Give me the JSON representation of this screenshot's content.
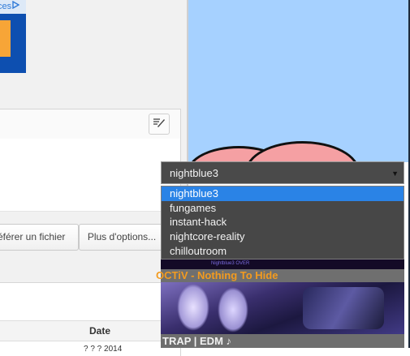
{
  "ad": {
    "label": "ces",
    "icon": "adchoices-icon"
  },
  "toolbar": {
    "edit_icon": "edit-icon"
  },
  "buttons": {
    "transfer_label": "éférer un fichier",
    "more_label": "Plus d'options..."
  },
  "table": {
    "header_date": "Date",
    "row_date": "? ? ? 2014"
  },
  "player": {
    "select_value": "nightblue3",
    "options": [
      "nightblue3",
      "fungames",
      "instant-hack",
      "nightcore-reality",
      "chilloutroom"
    ],
    "selected_index": 0,
    "banner_text": "Nightblue3 OVER",
    "song1": "OCTiV - Nothing To Hide",
    "song2": "TRAP | EDM ♪"
  },
  "colors": {
    "sky": "#a6d1ff",
    "selected": "#2a83e6",
    "song_title": "#f39b1f"
  }
}
